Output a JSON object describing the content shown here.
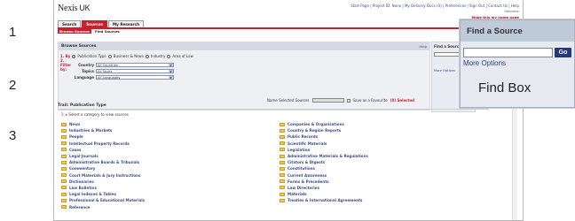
{
  "steps": [
    "1",
    "2",
    "3"
  ],
  "header": {
    "logo_main": "Nexis",
    "logo_suffix": "UK",
    "toplinks": "Start Page | Project ID: None | My Delivery Docs (0) | Preferences | Sign Out | Contact Us | Help",
    "helpdesk": "Helpdesk",
    "make_home": "Make this my home page"
  },
  "tabs": [
    {
      "label": "Search",
      "active": false
    },
    {
      "label": "Sources",
      "active": true
    },
    {
      "label": "My Research",
      "active": false
    }
  ],
  "subtabs": [
    {
      "label": "Browse Sources",
      "active": true
    },
    {
      "label": "Find Sources",
      "active": false
    }
  ],
  "browse": {
    "title": "Browse Sources",
    "help": "Help",
    "by_label": "1. By",
    "by_options": [
      {
        "label": "Publication Type",
        "selected": true
      },
      {
        "label": "Business & News",
        "selected": false
      },
      {
        "label": "Industry",
        "selected": false
      },
      {
        "label": "Area of Law",
        "selected": false
      }
    ],
    "filter_label": "2. Filter by:",
    "filters": [
      {
        "label": "Country",
        "value": "All Countries"
      },
      {
        "label": "Topics",
        "value": "All Topics"
      },
      {
        "label": "Language",
        "value": "All Languages"
      }
    ]
  },
  "find_box_small": {
    "title": "Find a Source",
    "more": "More Options"
  },
  "name_bar": {
    "label": "Name Selected Sources",
    "save_label": "Save as a Favourite",
    "selected_count": "(0) Selected"
  },
  "publication": {
    "trail": "Trail: Publication Type",
    "prompt": "Select a category to view sources",
    "step_num": "3.",
    "left": [
      "News",
      "Industries & Markets",
      "People",
      "Intellectual Property Records",
      "Cases",
      "Legal Journals",
      "Administrative Boards & Tribunals",
      "Commentary",
      "Court Materials & Jury Instructions",
      "Dictionaries",
      "Law Bulletins",
      "Legal Indexes & Tables",
      "Professional & Educational Materials",
      "Reference"
    ],
    "right": [
      "Companies & Organisations",
      "Country & Region Reports",
      "Public Records",
      "Scientific Materials",
      "Legislation",
      "Administrative Materials & Regulations",
      "Citators & Digests",
      "Constitutions",
      "Current Awareness",
      "Forms & Precedents",
      "Law Directories",
      "Materials",
      "Treaties & International Agreements"
    ]
  },
  "zoom_callout": {
    "title": "Find a Source",
    "go": "Go",
    "more": "More Options",
    "caption": "Find Box"
  },
  "colors": {
    "accent_red": "#c8202f",
    "link_blue": "#3d4e8a",
    "go_button": "#26377e",
    "folder_yellow": "#f3c94a"
  }
}
